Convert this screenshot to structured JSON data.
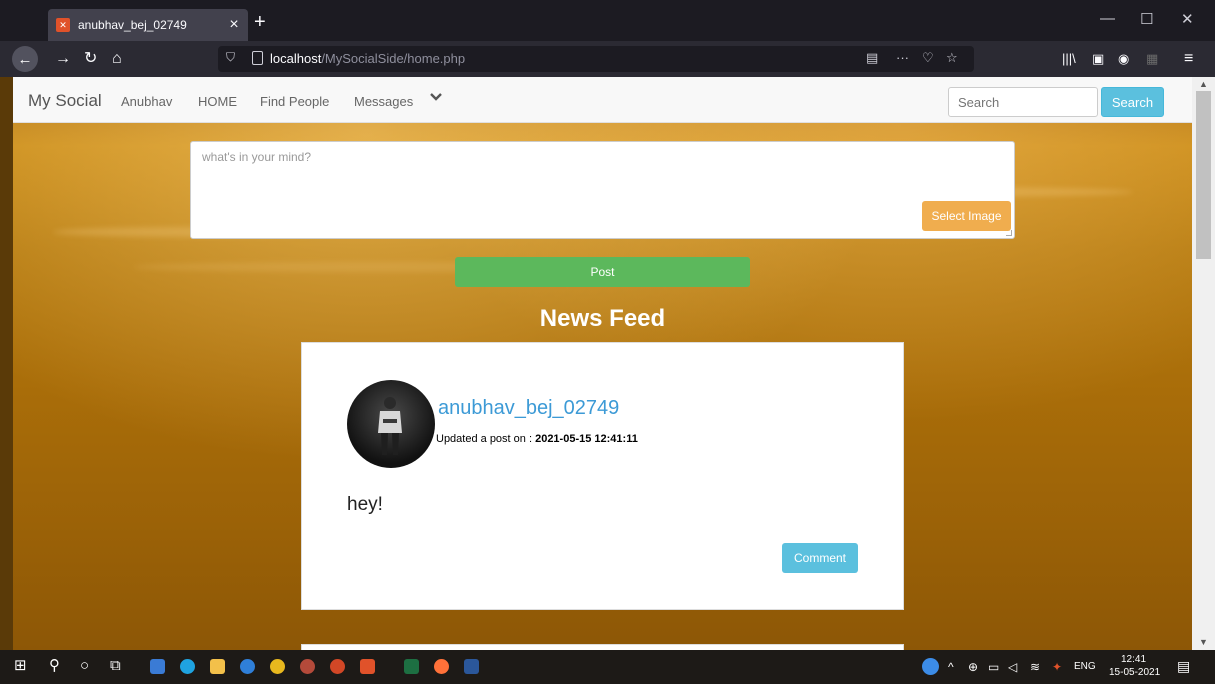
{
  "browser": {
    "tab_title": "anubhav_bej_02749",
    "tab_close": "×",
    "new_tab": "+",
    "url_host": "localhost",
    "url_path": "/MySocialSide/home.php"
  },
  "site": {
    "brand": "My Social",
    "nav": [
      "Anubhav",
      "HOME",
      "Find People",
      "Messages"
    ],
    "search_placeholder": "Search",
    "search_button": "Search"
  },
  "composer": {
    "placeholder": "what's in your mind?",
    "select_image": "Select Image",
    "post": "Post"
  },
  "feed": {
    "title": "News Feed",
    "posts": [
      {
        "username": "anubhav_bej_02749",
        "updated_prefix": "Updated a post on : ",
        "timestamp": "2021-05-15 12:41:11",
        "body": "hey!",
        "comment": "Comment"
      }
    ]
  },
  "taskbar": {
    "lang": "ENG",
    "time": "12:41",
    "date": "15-05-2021"
  },
  "colors": {
    "nav_bg": "#f8f8f8",
    "info": "#5bc0de",
    "warning": "#f0ad4e",
    "success": "#5cb85c",
    "username": "#3c9ad6"
  }
}
